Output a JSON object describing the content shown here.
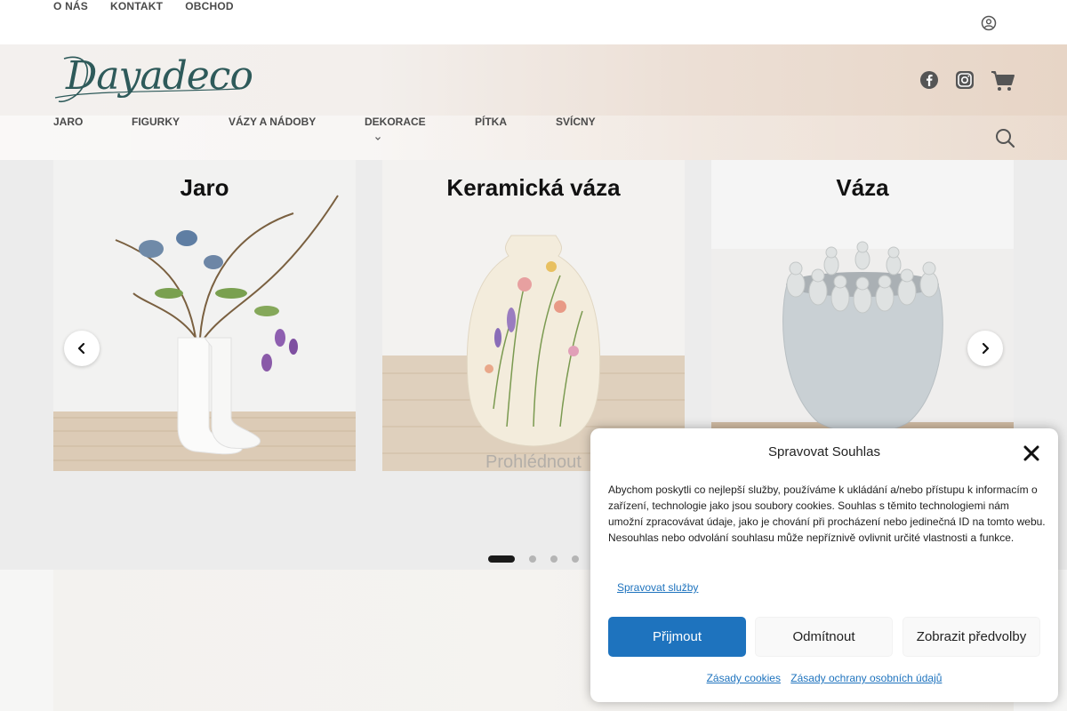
{
  "topbar": {
    "links": [
      "O NÁS",
      "KONTAKT",
      "OBCHOD"
    ]
  },
  "header": {
    "logo_text": "Dayadeco",
    "icons": [
      "account-icon",
      "facebook-icon",
      "instagram-icon",
      "cart-icon",
      "search-icon"
    ]
  },
  "mainnav": {
    "items": [
      "JARO",
      "FIGURKY",
      "VÁZY A NÁDOBY",
      "DEKORACE",
      "PÍTKA",
      "SVÍCNY"
    ]
  },
  "slider": {
    "cards": [
      {
        "title": "Jaro"
      },
      {
        "title": "Keramická váza"
      },
      {
        "title": "Váza"
      }
    ],
    "view_link": "Prohlédnout",
    "dots": 4,
    "active_dot": 0
  },
  "cookie": {
    "title": "Spravovat Souhlas",
    "body": "Abychom poskytli co nejlepší služby, používáme k ukládání a/nebo přístupu k informacím o zařízení, technologie jako jsou soubory cookies. Souhlas s těmito technologiemi nám umožní zpracovávat údaje, jako je chování při procházení nebo jedinečná ID na tomto webu. Nesouhlas nebo odvolání souhlasu může nepříznivě ovlivnit určité vlastnosti a funkce.",
    "manage_services": "Spravovat služby",
    "accept": "Přijmout",
    "deny": "Odmítnout",
    "preferences": "Zobrazit předvolby",
    "links": [
      "Zásady cookies",
      "Zásady ochrany osobních údajů"
    ]
  },
  "colors": {
    "accent": "#1e73be",
    "logo": "#2e5a5a",
    "slider_bg": "#ececec"
  }
}
